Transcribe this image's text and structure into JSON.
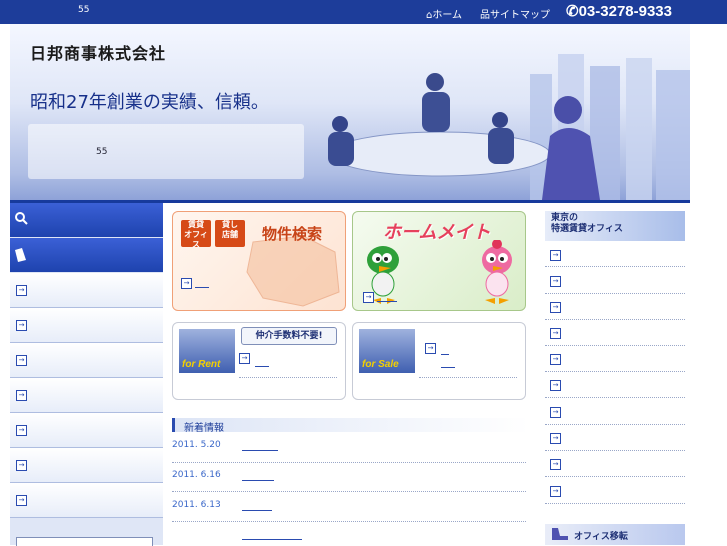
{
  "topbar": {
    "number": "55",
    "home_label": "ホーム",
    "sitemap_label": "サイトマップ",
    "phone": "03-3278-9333"
  },
  "header": {
    "company_name": "日邦商事株式会社",
    "slogan": "昭和27年創業の実績、信頼。",
    "banner_number": "55"
  },
  "cards": {
    "search": {
      "badge1": "賃貸\nオフィス",
      "badge2": "貸し\n店舗",
      "title": "物件検索"
    },
    "homemate": {
      "title": "ホームメイト"
    },
    "rent": {
      "photo_label": "for Rent",
      "fee_label": "仲介手数料不要!"
    },
    "sale": {
      "photo_label": "for Sale"
    }
  },
  "news": {
    "heading": "新着情報",
    "items": [
      {
        "date": "2011. 5.20"
      },
      {
        "date": "2011. 6.16"
      },
      {
        "date": "2011. 6.13"
      }
    ]
  },
  "right": {
    "heading_line1": "東京の",
    "heading_line2": "特選賃貸オフィス",
    "bottom_label": "オフィス移転"
  },
  "colors": {
    "brand_blue": "#1d3d9a",
    "link_blue": "#2a4bb0",
    "accent_orange": "#d64a17"
  }
}
